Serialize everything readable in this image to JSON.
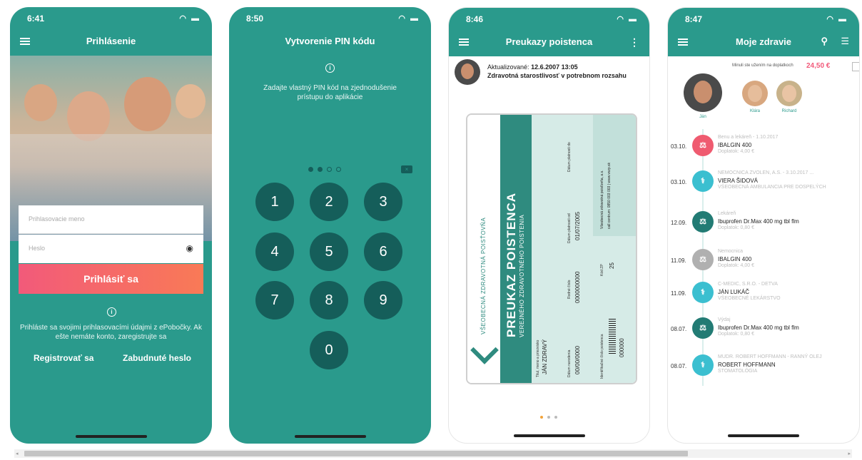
{
  "colors": {
    "teal": "#2a9a8c",
    "dark_teal": "#155e5a",
    "accent_pink": "#f25a7a",
    "accent_orange": "#f97a56",
    "card_green": "#2f8b7f"
  },
  "screen1": {
    "time": "6:41",
    "title": "Prihlásenie",
    "username_placeholder": "Prihlasovacie meno",
    "password_placeholder": "Heslo",
    "login_button": "Prihlásiť sa",
    "info_text": "Prihláste sa svojimi prihlasovacími údajmi z ePobočky. Ak ešte nemáte konto, zaregistrujte sa",
    "register_link": "Registrovať sa",
    "forgot_link": "Zabudnuté heslo"
  },
  "screen2": {
    "time": "8:50",
    "title": "Vytvorenie PIN kódu",
    "info_text": "Zadajte vlastný PIN kód na zjednodušenie prístupu do aplikácie",
    "keys": [
      "1",
      "2",
      "3",
      "4",
      "5",
      "6",
      "7",
      "8",
      "9",
      "0"
    ]
  },
  "screen3": {
    "time": "8:46",
    "title": "Preukazy poistenca",
    "updated_label": "Aktualizované:",
    "updated_value": "12.6.2007 13:05",
    "coverage": "Zdravotná starostlivosť v potrebnom rozsahu",
    "card": {
      "insurer": "VŠEOBECNÁ ZDRAVOTNÁ POISŤOVŇA",
      "title": "PREUKAZ POISTENCA",
      "subtitle": "VEREJNÉHO ZDRAVOTNÉHO POISTENIA",
      "name_label": "Titul, meno a priezvisko",
      "name_value": "JÁN ZDRAVÝ",
      "birth_label": "Dátum narodenia",
      "birth_value": "00/00/0000",
      "id_label": "Rodné číslo",
      "id_value": "0000000000",
      "valid_from_label": "Dátum platnosti od",
      "valid_from_value": "01/07/2005",
      "valid_to_label": "Dátum platnosti do",
      "code_label": "Kód ZP",
      "code_value": "25",
      "card_no_label": "Identifikačné číslo poistenca",
      "card_no_value": "000000",
      "company": "Všeobecná zdravotná poisťovňa, a.s.",
      "contact": "call centrum: 0850 003 003 | www.vszp.sk"
    }
  },
  "screen4": {
    "time": "8:47",
    "title": "Moje zdravie",
    "copay_label": "Minuli ste užením na doplatkoch",
    "copay_value": "24,50 €",
    "people": [
      {
        "name": "Ján"
      },
      {
        "name": "Klára"
      },
      {
        "name": "Richard"
      }
    ],
    "entries": [
      {
        "date": "03.10.",
        "type": "pharmacy",
        "color": "#ef5b70",
        "top": "Benu a lekáreň - 1.10.2017",
        "main": "IBALGIN 400",
        "sub": "Doplatok: 4,00 €"
      },
      {
        "date": "03.10.",
        "type": "doctor",
        "color": "#3bbfd0",
        "top": "NEMOCNICA ZVOLEN, A.S. - 3.10.2017 ...",
        "main": "VIERA ŠIDOVÁ",
        "sub": "VŠEOBECNÁ AMBULANCIA PRE DOSPELÝCH"
      },
      {
        "date": "12.09.",
        "type": "pharmacy",
        "color": "#227b74",
        "top": "Lekáreň",
        "main": "Ibuprofen Dr.Max 400 mg tbl flm",
        "sub": "Doplatok: 0,80 €"
      },
      {
        "date": "11.09.",
        "type": "pharmacy",
        "color": "#b0b0b0",
        "top": "Nemocnica",
        "main": "IBALGIN 400",
        "sub": "Doplatok: 4,00 €"
      },
      {
        "date": "11.09.",
        "type": "doctor",
        "color": "#3bbfd0",
        "top": "C-MEDIC, S.R.O. - DETVA",
        "main": "JÁN LUKÁČ",
        "sub": "VŠEOBECNÉ LEKÁRSTVO"
      },
      {
        "date": "08.07.",
        "type": "pharmacy",
        "color": "#227b74",
        "top": "Výdaj",
        "main": "Ibuprofen Dr.Max 400 mg tbl flm",
        "sub": "Doplatok: 0,80 €"
      },
      {
        "date": "08.07.",
        "type": "doctor",
        "color": "#3bbfd0",
        "top": "MUDR. ROBERT HOFFMANN - RANNÝ OLEJ",
        "main": "ROBERT HOFFMANN",
        "sub": "STOMATOLÓGIA"
      }
    ]
  }
}
